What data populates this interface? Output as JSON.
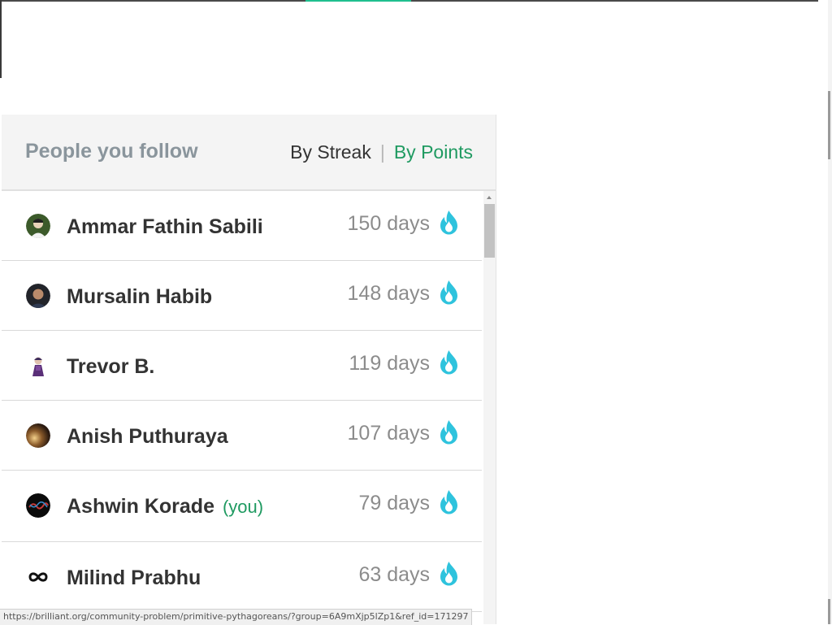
{
  "panel": {
    "title": "People you follow",
    "sort": {
      "by_streak": "By Streak",
      "by_points": "By Points",
      "active": "By Points"
    }
  },
  "people": [
    {
      "name": "Ammar Fathin Sabili",
      "days": "150 days",
      "you": ""
    },
    {
      "name": "Mursalin Habib",
      "days": "148 days",
      "you": ""
    },
    {
      "name": "Trevor B.",
      "days": "119 days",
      "you": ""
    },
    {
      "name": "Anish Puthuraya",
      "days": "107 days",
      "you": ""
    },
    {
      "name": "Ashwin Korade",
      "days": "79 days",
      "you": "(you)"
    },
    {
      "name": "Milind Prabhu",
      "days": "63 days",
      "you": ""
    }
  ],
  "status_url": "https://brilliant.org/community-problem/primitive-pythagoreans/?group=6A9mXjp5lZp1&ref_id=171297",
  "icons": {
    "streak": "flame-icon"
  },
  "colors": {
    "accent": "#1f9a61",
    "flame": "#2ec3dd",
    "title": "#8a959c"
  }
}
